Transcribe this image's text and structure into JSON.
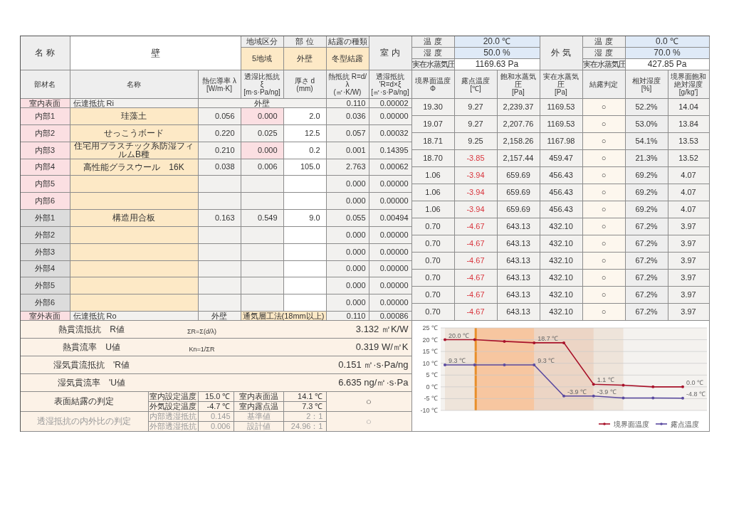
{
  "header": {
    "name_label": "名 称",
    "name_value": "壁",
    "region": {
      "label": "地域区分",
      "value": "5地域"
    },
    "part": {
      "label": "部 位",
      "value": "外壁"
    },
    "condensation_type": {
      "label": "結露の種類",
      "value": "冬型結露"
    },
    "indoor": {
      "label": "室 内",
      "temperature_label": "温 度",
      "temperature": "20.0 ℃",
      "humidity_label": "湿 度",
      "humidity": "50.0 %",
      "vapor_label": "実在水蒸気圧",
      "vapor": "1169.63 Pa"
    },
    "outdoor": {
      "label": "外 気",
      "temperature_label": "温 度",
      "temperature": "0.0 ℃",
      "humidity_label": "湿 度",
      "humidity": "70.0 %",
      "vapor_label": "実在水蒸気圧",
      "vapor": "427.85 Pa"
    }
  },
  "columns": [
    {
      "title": "部材名"
    },
    {
      "title": "名称"
    },
    {
      "title": "熱伝導率 λ",
      "unit": "[W/m·K]"
    },
    {
      "title": "透湿比抵抗 ξ",
      "unit": "[m·s·Pa/ng]"
    },
    {
      "title": "厚さ d",
      "unit": "(mm)"
    },
    {
      "title": "熱抵抗 R=d/λ",
      "unit": "(㎡·K/W)"
    },
    {
      "title": "透湿抵抗 'R=d×ξ",
      "unit": "[㎡·s·Pa/ng]"
    },
    {
      "title": "境界面温度",
      "unit": "Φ"
    },
    {
      "title": "露点温度",
      "unit": "[℃]"
    },
    {
      "title": "飽和水蒸気圧",
      "unit": "[Pa]"
    },
    {
      "title": "実在水蒸気圧",
      "unit": "[Pa]"
    },
    {
      "title": "結露判定"
    },
    {
      "title": "相対湿度",
      "unit": "[%]"
    },
    {
      "title": "境界面飽和絶対湿度",
      "unit": "[g/kg']"
    }
  ],
  "layers": [
    {
      "kind": "surface",
      "label": "室内表面",
      "name": "伝達抵抗 Ri",
      "note": "外壁",
      "r": "0.110",
      "rd": "0.00002"
    },
    {
      "kind": "inner",
      "label": "内部1",
      "name": "珪藻土",
      "lambda": "0.056",
      "xi": "0.000",
      "xi_flagged": true,
      "d": "2.0",
      "r": "0.036",
      "rd": "0.00000"
    },
    {
      "kind": "inner",
      "label": "内部2",
      "name": "せっこうボード",
      "lambda": "0.220",
      "xi": "0.025",
      "xi_flagged": false,
      "d": "12.5",
      "r": "0.057",
      "rd": "0.00032"
    },
    {
      "kind": "inner",
      "label": "内部3",
      "name": "住宅用プラスチック系防湿フィルムB種",
      "lambda": "0.210",
      "xi": "0.000",
      "xi_flagged": true,
      "d": "0.2",
      "r": "0.001",
      "rd": "0.14395"
    },
    {
      "kind": "inner",
      "label": "内部4",
      "name": "高性能グラスウール　16K",
      "lambda": "0.038",
      "xi": "0.006",
      "xi_flagged": false,
      "d": "105.0",
      "r": "2.763",
      "rd": "0.00062"
    },
    {
      "kind": "inner",
      "label": "内部5",
      "xi_flagged": false,
      "r": "0.000",
      "rd": "0.00000"
    },
    {
      "kind": "inner",
      "label": "内部6",
      "xi_flagged": false,
      "r": "0.000",
      "rd": "0.00000"
    },
    {
      "kind": "outer",
      "label": "外部1",
      "name": "構造用合板",
      "lambda": "0.163",
      "xi": "0.549",
      "xi_flagged": false,
      "d": "9.0",
      "r": "0.055",
      "rd": "0.00494"
    },
    {
      "kind": "outer",
      "label": "外部2",
      "xi_flagged": false,
      "r": "0.000",
      "rd": "0.00000"
    },
    {
      "kind": "outer",
      "label": "外部3",
      "xi_flagged": false,
      "r": "0.000",
      "rd": "0.00000"
    },
    {
      "kind": "outer",
      "label": "外部4",
      "xi_flagged": false,
      "r": "0.000",
      "rd": "0.00000"
    },
    {
      "kind": "outer",
      "label": "外部5",
      "xi_flagged": false,
      "r": "0.000",
      "rd": "0.00000"
    },
    {
      "kind": "outer",
      "label": "外部6",
      "xi_flagged": false,
      "r": "0.000",
      "rd": "0.00000"
    },
    {
      "kind": "surface",
      "label": "室外表面",
      "name": "伝達抵抗 Ro",
      "note": "外壁",
      "method": "通気層工法(18mm以上)",
      "r": "0.110",
      "rd": "0.00086"
    }
  ],
  "interfaces": [
    {
      "temp": "19.30",
      "dew": "9.27",
      "dew_negative": false,
      "sat": "2,239.37",
      "vapor": "1169.53",
      "judgement": "○",
      "rh": "52.2%",
      "abs": "14.04"
    },
    {
      "temp": "19.07",
      "dew": "9.27",
      "dew_negative": false,
      "sat": "2,207.76",
      "vapor": "1169.53",
      "judgement": "○",
      "rh": "53.0%",
      "abs": "13.84"
    },
    {
      "temp": "18.71",
      "dew": "9.25",
      "dew_negative": false,
      "sat": "2,158.26",
      "vapor": "1167.98",
      "judgement": "○",
      "rh": "54.1%",
      "abs": "13.53"
    },
    {
      "temp": "18.70",
      "dew": "-3.85",
      "dew_negative": true,
      "sat": "2,157.44",
      "vapor": "459.47",
      "judgement": "○",
      "rh": "21.3%",
      "abs": "13.52"
    },
    {
      "temp": "1.06",
      "dew": "-3.94",
      "dew_negative": true,
      "sat": "659.69",
      "vapor": "456.43",
      "judgement": "○",
      "rh": "69.2%",
      "abs": "4.07"
    },
    {
      "temp": "1.06",
      "dew": "-3.94",
      "dew_negative": true,
      "sat": "659.69",
      "vapor": "456.43",
      "judgement": "○",
      "rh": "69.2%",
      "abs": "4.07"
    },
    {
      "temp": "1.06",
      "dew": "-3.94",
      "dew_negative": true,
      "sat": "659.69",
      "vapor": "456.43",
      "judgement": "○",
      "rh": "69.2%",
      "abs": "4.07"
    },
    {
      "temp": "0.70",
      "dew": "-4.67",
      "dew_negative": true,
      "sat": "643.13",
      "vapor": "432.10",
      "judgement": "○",
      "rh": "67.2%",
      "abs": "3.97"
    },
    {
      "temp": "0.70",
      "dew": "-4.67",
      "dew_negative": true,
      "sat": "643.13",
      "vapor": "432.10",
      "judgement": "○",
      "rh": "67.2%",
      "abs": "3.97"
    },
    {
      "temp": "0.70",
      "dew": "-4.67",
      "dew_negative": true,
      "sat": "643.13",
      "vapor": "432.10",
      "judgement": "○",
      "rh": "67.2%",
      "abs": "3.97"
    },
    {
      "temp": "0.70",
      "dew": "-4.67",
      "dew_negative": true,
      "sat": "643.13",
      "vapor": "432.10",
      "judgement": "○",
      "rh": "67.2%",
      "abs": "3.97"
    },
    {
      "temp": "0.70",
      "dew": "-4.67",
      "dew_negative": true,
      "sat": "643.13",
      "vapor": "432.10",
      "judgement": "○",
      "rh": "67.2%",
      "abs": "3.97"
    },
    {
      "temp": "0.70",
      "dew": "-4.67",
      "dew_negative": true,
      "sat": "643.13",
      "vapor": "432.10",
      "judgement": "○",
      "rh": "67.2%",
      "abs": "3.97"
    }
  ],
  "results": [
    {
      "label": "熱貫流抵抗　R値",
      "formula": "ΣR=Σ(d/λ)",
      "value": "3.132 ㎡K/W"
    },
    {
      "label": "熱貫流率　U値",
      "formula": "Kn=1/ΣR",
      "value": "0.319 W/㎡K"
    },
    {
      "label": "湿気貫流抵抗　'R値",
      "value": "0.151 ㎡·s·Pa/ng"
    },
    {
      "label": "湿気貫流率　'U値",
      "value": "6.635 ng/㎡·s·Pa"
    }
  ],
  "checks": [
    {
      "label": "表面結露の判定",
      "dimmed": false,
      "result": "○",
      "rows": [
        {
          "label": "室内設定温度",
          "value": "15.0 ℃",
          "label2": "室内表面温",
          "value2": "14.1 ℃"
        },
        {
          "label": "外気設定温度",
          "value": "-4.7 ℃",
          "label2": "室内露点温",
          "value2": "7.3 ℃"
        }
      ]
    },
    {
      "label": "透湿抵抗の内外比の判定",
      "dimmed": true,
      "result": "○",
      "rows": [
        {
          "label": "内部透湿抵抗",
          "value": "0.145",
          "label2": "基準値",
          "value2": "2：1"
        },
        {
          "label": "外部透湿抵抗",
          "value": "0.006",
          "label2": "設計値",
          "value2": "24.96：1"
        }
      ]
    }
  ],
  "chart": {
    "chart_data": {
      "type": "line",
      "categories": [
        null,
        null,
        null,
        null,
        null,
        null,
        null,
        null,
        null
      ],
      "grid": true,
      "legend": "bottom-right",
      "ylim": [
        -10,
        25
      ],
      "yticks": [
        {
          "value": 25,
          "label": "25 ℃"
        },
        {
          "value": 20,
          "label": "20 ℃"
        },
        {
          "value": 15,
          "label": "15 ℃"
        },
        {
          "value": 10,
          "label": "10 ℃"
        },
        {
          "value": 5,
          "label": "5 ℃"
        },
        {
          "value": 0,
          "label": "0 ℃"
        },
        {
          "value": -5,
          "label": "-5 ℃"
        },
        {
          "value": -10,
          "label": "-10 ℃"
        }
      ],
      "series": [
        {
          "name": "境界面温度",
          "color": "#a8122a",
          "values": [
            20.0,
            20.0,
            19.3,
            18.7,
            18.7,
            1.1,
            0.7,
            0.0,
            0.0
          ],
          "value_labels": [
            "20.0 ℃",
            null,
            null,
            "18.7 ℃",
            null,
            "1.1 ℃",
            null,
            null,
            "0.0 ℃"
          ]
        },
        {
          "name": "露点温度",
          "color": "#5a4aa0",
          "values": [
            9.3,
            9.3,
            9.3,
            9.3,
            -3.9,
            -3.9,
            -4.7,
            -4.7,
            -4.8
          ],
          "value_labels": [
            "9.3 ℃",
            null,
            null,
            "9.3 ℃",
            "-3.9 ℃",
            "-3.9 ℃",
            null,
            null,
            "-4.8 ℃"
          ]
        }
      ]
    }
  }
}
